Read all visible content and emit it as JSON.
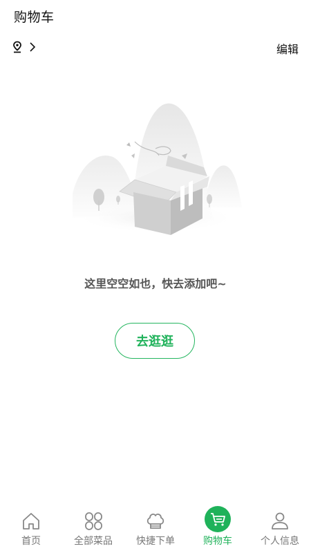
{
  "header": {
    "title": "购物车",
    "edit_label": "编辑"
  },
  "empty_state": {
    "message": "这里空空如也，快去添加吧~",
    "button_label": "去逛逛"
  },
  "tabbar": {
    "tabs": [
      {
        "label": "首页",
        "icon": "home-icon",
        "active": false
      },
      {
        "label": "全部菜品",
        "icon": "grid-icon",
        "active": false
      },
      {
        "label": "快捷下单",
        "icon": "chef-hat-icon",
        "active": false
      },
      {
        "label": "购物车",
        "icon": "cart-icon",
        "active": true
      },
      {
        "label": "个人信息",
        "icon": "user-icon",
        "active": false
      }
    ]
  },
  "colors": {
    "accent": "#1fb25a",
    "inactive": "#777777",
    "message": "#555555"
  }
}
